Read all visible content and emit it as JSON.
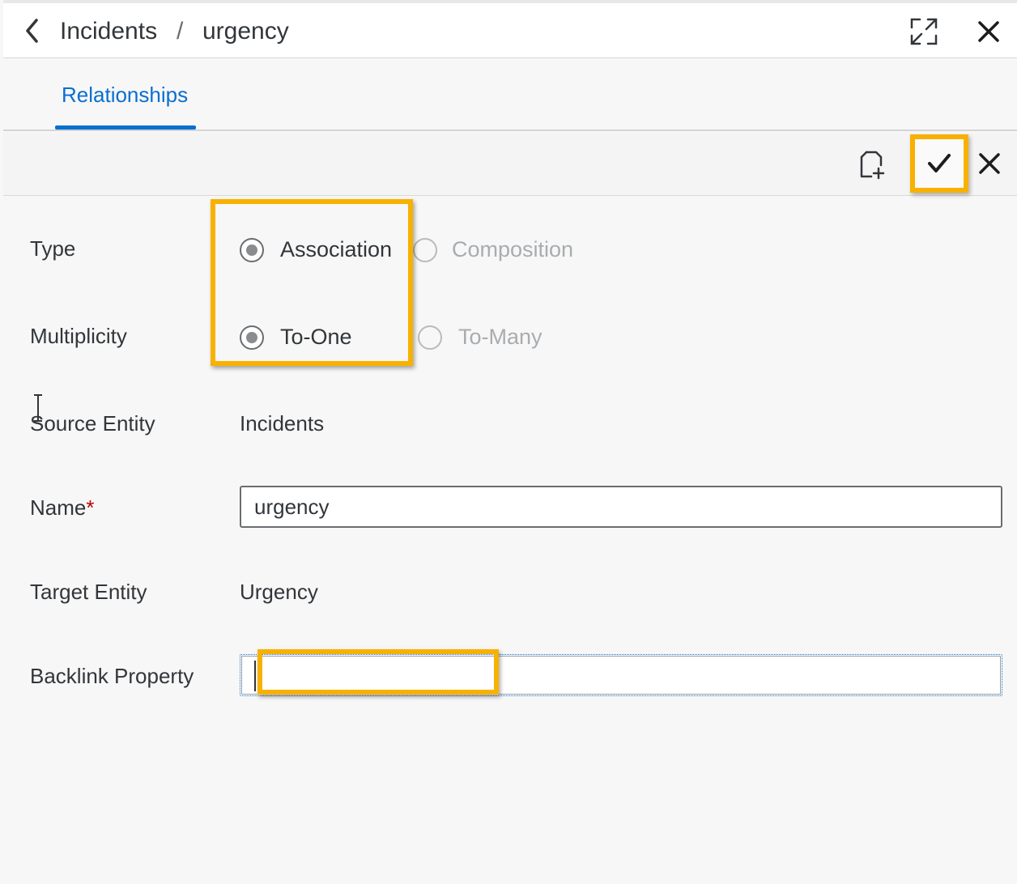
{
  "header": {
    "breadcrumb": [
      "Incidents",
      "urgency"
    ],
    "separator": "/"
  },
  "tabs": [
    {
      "label": "Relationships",
      "active": true
    }
  ],
  "toolbar": {
    "buttons": [
      "copy-icon",
      "confirm-icon",
      "close-icon"
    ]
  },
  "form": {
    "type": {
      "label": "Type",
      "options": [
        {
          "label": "Association",
          "selected": true,
          "enabled": true
        },
        {
          "label": "Composition",
          "selected": false,
          "enabled": false
        }
      ]
    },
    "multiplicity": {
      "label": "Multiplicity",
      "options": [
        {
          "label": "To-One",
          "selected": true,
          "enabled": true
        },
        {
          "label": "To-Many",
          "selected": false,
          "enabled": false
        }
      ]
    },
    "source_entity": {
      "label": "Source Entity",
      "value": "Incidents"
    },
    "name": {
      "label": "Name",
      "required_mark": "*",
      "value": "urgency"
    },
    "target_entity": {
      "label": "Target Entity",
      "value": "Urgency"
    },
    "backlink_property": {
      "label": "Backlink Property",
      "value": ""
    }
  },
  "colors": {
    "accent": "#0a6ed1",
    "highlight": "#f8b100",
    "required": "#bb0000"
  }
}
